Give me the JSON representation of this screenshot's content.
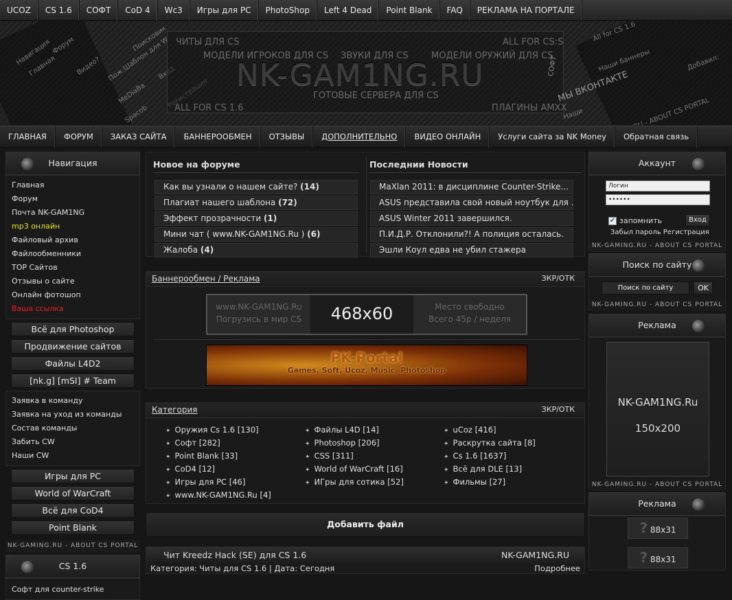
{
  "top_nav": [
    "UCOZ",
    "CS 1.6",
    "СОФТ",
    "CoD 4",
    "Wc3",
    "Игры для PC",
    "PhotoShop",
    "Left 4 Dead",
    "Point Blank",
    "FAQ",
    "РЕКЛАМА НА ПОРТАЛЕ"
  ],
  "banner": {
    "logo": "NK-GAM1NG.RU",
    "tagline": "ГОТОВЫЕ СЕРВЕРА ДЛЯ CS",
    "words": [
      "ЧИТЫ ДЛЯ CS",
      "МОДЕЛИ ИГРОКОВ ДЛЯ CS",
      "ЗВУКИ ДЛЯ CS",
      "МОДЕЛИ ОРУЖИЙ ДЛЯ CS",
      "ALL FOR CS:S",
      "ALL FOR CS 1.6",
      "ПЛАГИНЫ AMXX",
      "МЫ ВКОНТАКТЕ",
      "СОФТ"
    ],
    "left_diag": [
      "Навигация",
      "Главная",
      "Форум",
      "Видео?",
      "Пож.Шаблон для W",
      "Поисковик",
      "MeDiaBa",
      "Spacob",
      "Вход",
      "Регистрация"
    ],
    "right_diag": [
      "All for CS 1.6",
      "Наши баннеры",
      "Добавил: ",
      "NK-GAMING.RU - ABOUT CS PORTAL",
      "Наши"
    ]
  },
  "main_nav": [
    "ГЛАВНАЯ",
    "ФОРУМ",
    "ЗАКАЗ САЙТА",
    "БАННЕРООБМЕН",
    "ОТЗЫВЫ",
    "ДОПОЛНИТЕЛЬНО",
    "ВИДЕО ОНЛАЙН",
    "Услуги сайта за NK Money",
    "Обратная связь"
  ],
  "left": {
    "nav_title": "Навигация",
    "links": [
      "Главная",
      "Форум",
      "Почта NK-GAM1NG",
      "mp3 онлайн",
      "Файловый архив",
      "Файлообменники",
      "TOP Сайтов",
      "Отзывы о сайте",
      "Онлайн фотошоп",
      "Ваша ссылка"
    ],
    "link_colors": [
      "#e0e0e0",
      "#e0e0e0",
      "#e0e0e0",
      "#e6e600",
      "#e0e0e0",
      "#e0e0e0",
      "#e0e0e0",
      "#e0e0e0",
      "#e0e0e0",
      "#e22222"
    ],
    "buttons1": [
      "Всё для Photoshop",
      "Продвижение сайтов",
      "Файлы L4D2",
      "[nk.g] [mSI] # Team"
    ],
    "team_links": [
      "Заявка в команду",
      "Заявка на уход из команды",
      "Состав команды",
      "Забить CW",
      "Наши CW"
    ],
    "buttons2": [
      "Игры для PC",
      "World of WarCraft",
      "Всё для CoD4",
      "Point Blank"
    ],
    "strip": "NK-GAMING.RU - ABOUT CS PORTAL",
    "cs_title": "CS 1.6",
    "cs_links": [
      "Софт для counter-strike"
    ]
  },
  "center": {
    "forum_title": "Новое на форуме",
    "forum": [
      {
        "t": "Как вы узнали о нашем сайте? ",
        "n": "(14)"
      },
      {
        "t": "Плагиат нашего шаблона ",
        "n": "(72)"
      },
      {
        "t": "Эффект прозрачности ",
        "n": "(1)"
      },
      {
        "t": "Мини чат ( www.NK-GAM1NG.Ru ) ",
        "n": "(6)"
      },
      {
        "t": "Жалоба ",
        "n": "(4)"
      }
    ],
    "news_title": "Последнии Новости",
    "news": [
      "MaXlan 2011: в дисциплине Counter-Strike…",
      "ASUS представила свой новый ноутбук для …",
      "ASUS Winter 2011 завершился.",
      "П.И.Д.Р. Отклонили?! А полиция осталась.",
      "Эшли Коул едва не убил стажера"
    ],
    "banner_title": "Баннерообмен / Реклама",
    "banner_right": "ЗКР/ОТК",
    "ad468": {
      "left1": "www.NK-GAM1NG.Ru",
      "left2": "Погрузись в мир CS",
      "size": "468x60",
      "right1": "Место свободно",
      "right2": "Всего 45р / неделя"
    },
    "pk": {
      "title": "PK-Portal",
      "sub": "Games, Soft, Ucoz, Music, Photoshop"
    },
    "cat_title": "Категория",
    "cat_right": "ЗКР/ОТК",
    "cats": [
      [
        "Оружия Cs 1.6 [130]",
        "Софт [282]",
        "Point Blank [33]",
        "CoD4 [12]",
        "Игры для PC [46]",
        "www.NK-GAM1NG.Ru [4]"
      ],
      [
        "Файлы L4D [14]",
        "Photoshop [206]",
        "CSS [311]",
        "World of WarCraft [16]",
        "ИГры для сотика [52]"
      ],
      [
        "uCoz [416]",
        "Раскрутка сайта [8]",
        "Cs 1.6 [1637]",
        "Всё для DLE [13]",
        "Фильмы [27]"
      ]
    ],
    "add_file": "Добавить файл",
    "post": {
      "title": "Чит Kreedz Hack (SE) для CS 1.6",
      "site": "NK-GAM1NG.RU",
      "meta": "Категория: Читы для CS 1.6 | Дата: Сегодня",
      "more": "Подробнее"
    }
  },
  "right": {
    "account_title": "Аккаунт",
    "login_ph": "Логин",
    "pass_mask": "••••••",
    "remember": "запомнить",
    "enter": "Вход",
    "forgot": "Забыл пароль Регистрация",
    "strip": "NK-GAMING.RU - ABOUT CS PORTAL",
    "search_title": "Поиск по сайту",
    "search_ph": "Поиск по сайту",
    "ok": "OK",
    "ad_title": "Реклама",
    "ad_site": "NK-GAM1NG.Ru",
    "ad_size": "150x200",
    "ad2_title": "Реклама",
    "small_ad": "88x31"
  }
}
